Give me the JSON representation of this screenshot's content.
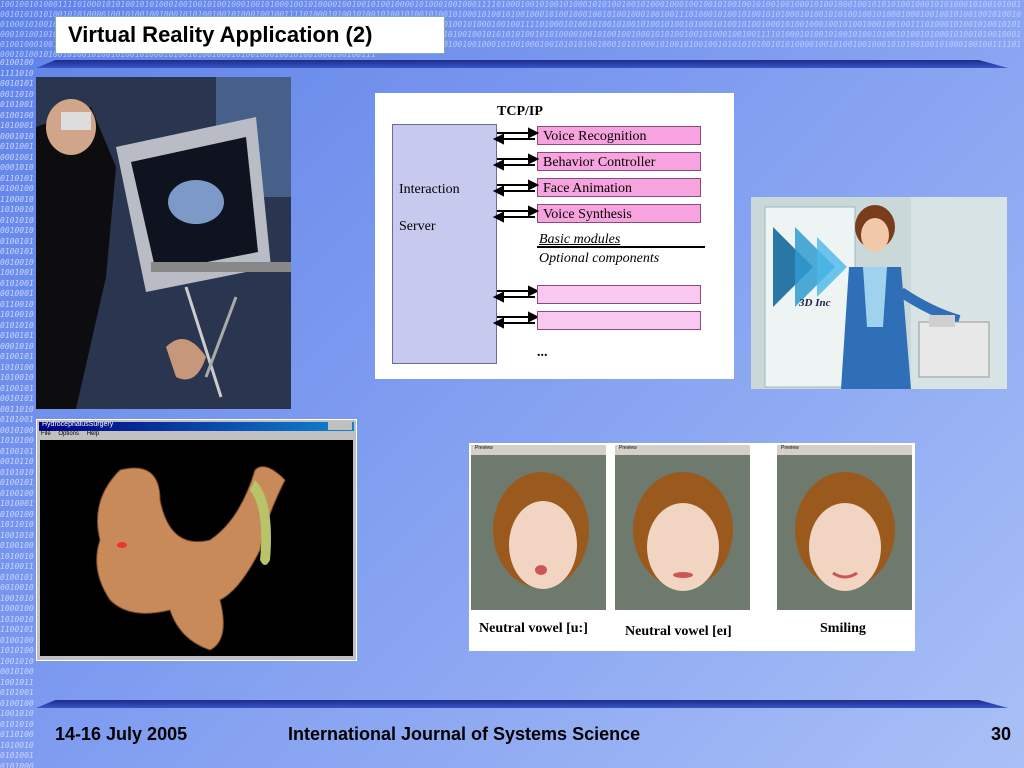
{
  "slide": {
    "title": "Virtual Reality Application (2)",
    "binary_top": "1001001010001111010001010100101010001001001010010001001010001001010000100100101001000010100010010001111010001001010010100010101001001010001000100100101001001010010010001010010001001010101001000101010001010010100100101010101001010100001001010010010001010100100101000100100111101000101001010010100101001010010100010100101001000101001000100101001000100100111010001010010100101010001010010101001001010001000100100101001001010010010001010010001001010101001000101010001010010100100101010101001010100001001010010010001010100100101000100100111101000101001010010100101001010010100010100101001000101001000100101001000100100111010001010010100101010001010010101001001010001000100100101001001010010010001010010001001010101001000101010001010010100100101010101001010100001001010010010001010100100101000100100111101000101001010010100101001010010100010100101001000101001000100101001000100100111010001010010100101010001010010101001001010001000100100101001001010010010001010010001001010101001000101010001010010100100101010101001010100001001010010010001010100100101000100100111101000101001010010100101001010010100010100101001000101001000100101001000100100111",
    "binary_left": "010010011110100010101001101001010010100100101000100010100101001000100100010100110101010010011000101010010010101000100100100101010010100100101001001010100100100010110010101001001010100100101000101001001011010100101001001001010010101001101001010010010100101010001001010010110010101001001010100100101000101001001011010100101001001001010010101001101001010010010100101010001001010010110010101001001010100100101000101001001011010100101001001001010010101001101001010010010100101010001001010010110010101001001010100100101000101001001011010100101001001001010010101001101001010010010100101010001001010010110010101001001010100100101000101001001011010100101001001001010010101001101001010010010100101010001001010010110010101001001010100100101000101001001011010100101001001001010010101001101001010010010100101010001001010010110010101001001010100100101000101001001011010100101001001001010010101001101001010010010100101010001001010010110010101001001010100100101000101001001011010100101001"
  },
  "diagram": {
    "protocol": "TCP/IP",
    "server_line1": "Interaction",
    "server_line2": "Server",
    "modules": [
      "Voice Recognition",
      "Behavior Controller",
      "Face Animation",
      "Voice Synthesis"
    ],
    "legend_basic": "Basic modules",
    "legend_optional": "Optional components",
    "ellipsis": "..."
  },
  "avatar": {
    "logo_text": "3D Inc"
  },
  "medical_window": {
    "title": "HydrocephalusSurgery",
    "menu": [
      "File",
      "Options",
      "Help"
    ]
  },
  "faces": {
    "window_title": "Preview",
    "labels": [
      "Neutral vowel [u:]",
      "Neutral vowel [eɪ]",
      "Smiling"
    ]
  },
  "footer": {
    "date": "14-16 July 2005",
    "journal": "International Journal of Systems Science",
    "page": "30"
  },
  "colors": {
    "module_fill": "#f7a3e0",
    "server_fill": "#c7c9ee",
    "rule": "#1c2c8a"
  }
}
